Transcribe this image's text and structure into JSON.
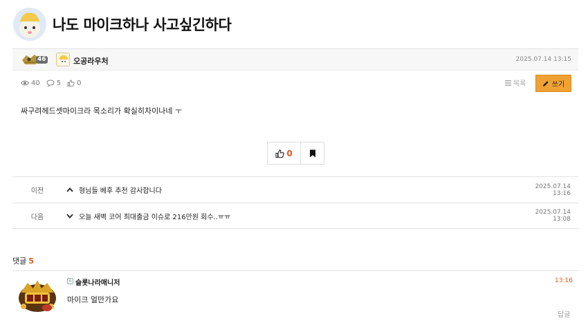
{
  "post": {
    "title": "나도 마이크하나 사고싶긴하다",
    "author": "오공라우처",
    "level": "46",
    "date": "2025.07.14 13:15",
    "views": "40",
    "comments": "5",
    "likes": "0",
    "body": "싸구려헤드셋마이크라 목소리가 확실히차이나네 ㅜ"
  },
  "toolbar": {
    "list_label": "목록",
    "write_label": "쓰기"
  },
  "vote": {
    "like_count": "0"
  },
  "nav": {
    "prev": {
      "label": "이전",
      "title": "형님들 베후 추천 감사합니다",
      "date": "2025.07.14 13:16"
    },
    "next": {
      "label": "다음",
      "title": "오늘 새벽 코어 최대출금 이슈로 216만원 회수..ㅠㅠ",
      "date": "2025.07.14 13:08"
    }
  },
  "comments_section": {
    "label": "댓글",
    "count": "5",
    "items": [
      {
        "author": "슬롯나라매니저",
        "time": "13:16",
        "text": "마이크 얼만가요",
        "reply_label": "답글"
      }
    ]
  },
  "colors": {
    "accent": "#f0a133",
    "highlight": "#e05a16"
  }
}
